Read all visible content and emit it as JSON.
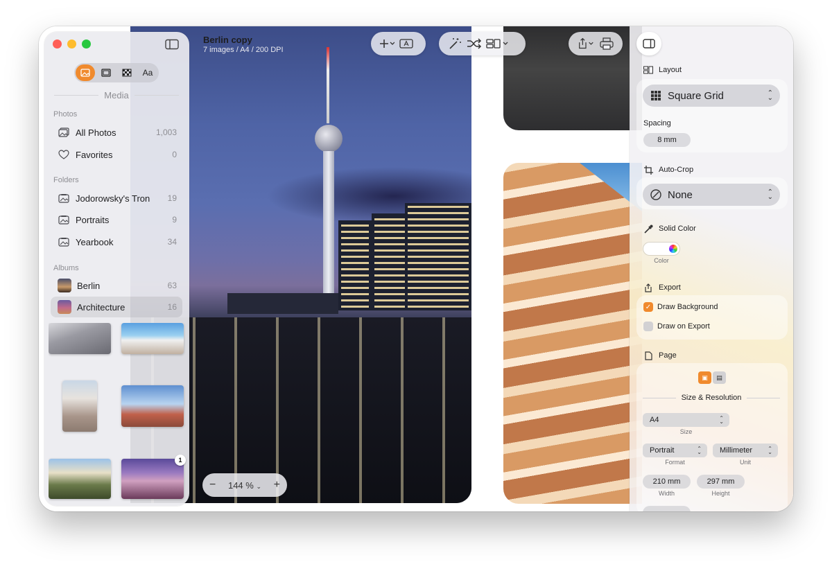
{
  "document": {
    "title": "Berlin copy",
    "subtitle": "7 images / A4 / 200 DPI"
  },
  "sidebar": {
    "tabs": [
      {
        "name": "photos",
        "icon": "photo-icon",
        "active": true
      },
      {
        "name": "frame",
        "icon": "frame-icon",
        "active": false
      },
      {
        "name": "background",
        "icon": "checkerboard-icon",
        "active": false
      },
      {
        "name": "text",
        "label": "Aa",
        "active": false
      }
    ],
    "media_label": "Media",
    "photos_section": "Photos",
    "photos_items": [
      {
        "label": "All Photos",
        "count": "1,003",
        "icon": "photos-stack-icon"
      },
      {
        "label": "Favorites",
        "count": "0",
        "icon": "heart-icon"
      }
    ],
    "folders_section": "Folders",
    "folders_items": [
      {
        "label": "Jodorowsky's Tron",
        "count": "19"
      },
      {
        "label": "Portraits",
        "count": "9"
      },
      {
        "label": "Yearbook",
        "count": "34"
      }
    ],
    "albums_section": "Albums",
    "albums_items": [
      {
        "label": "Berlin",
        "count": "63",
        "selected": false
      },
      {
        "label": "Architecture",
        "count": "16",
        "selected": true
      }
    ],
    "thumbnail_badge": "1"
  },
  "toolbar": {
    "add_icon": "plus-icon",
    "text_icon": "text-box-icon",
    "magic_icon": "magic-wand-icon",
    "shuffle_icon": "shuffle-icon",
    "layout_icon": "layout-icon",
    "share_icon": "share-icon",
    "print_icon": "print-icon"
  },
  "zoom": {
    "minus": "−",
    "value": "144 %",
    "plus": "+"
  },
  "inspector": {
    "layout_label": "Layout",
    "layout_value": "Square Grid",
    "spacing_label": "Spacing",
    "spacing_value": "8 mm",
    "autocrop_label": "Auto-Crop",
    "autocrop_value": "None",
    "solid_color_label": "Solid Color",
    "color_label": "Color",
    "export_label": "Export",
    "draw_background_label": "Draw Background",
    "draw_background_checked": true,
    "draw_on_export_label": "Draw on Export",
    "draw_on_export_checked": false,
    "page_label": "Page",
    "size_resolution_label": "Size & Resolution",
    "size_value": "A4",
    "size_label": "Size",
    "format_value": "Portrait",
    "format_label": "Format",
    "unit_value": "Millimeter",
    "unit_label": "Unit",
    "width_value": "210 mm",
    "width_label": "Width",
    "height_value": "297 mm",
    "height_label": "Height"
  },
  "colors": {
    "accent": "#f08a2d",
    "close": "#ff5f57",
    "minimize": "#febc2e",
    "zoom": "#28c840"
  }
}
